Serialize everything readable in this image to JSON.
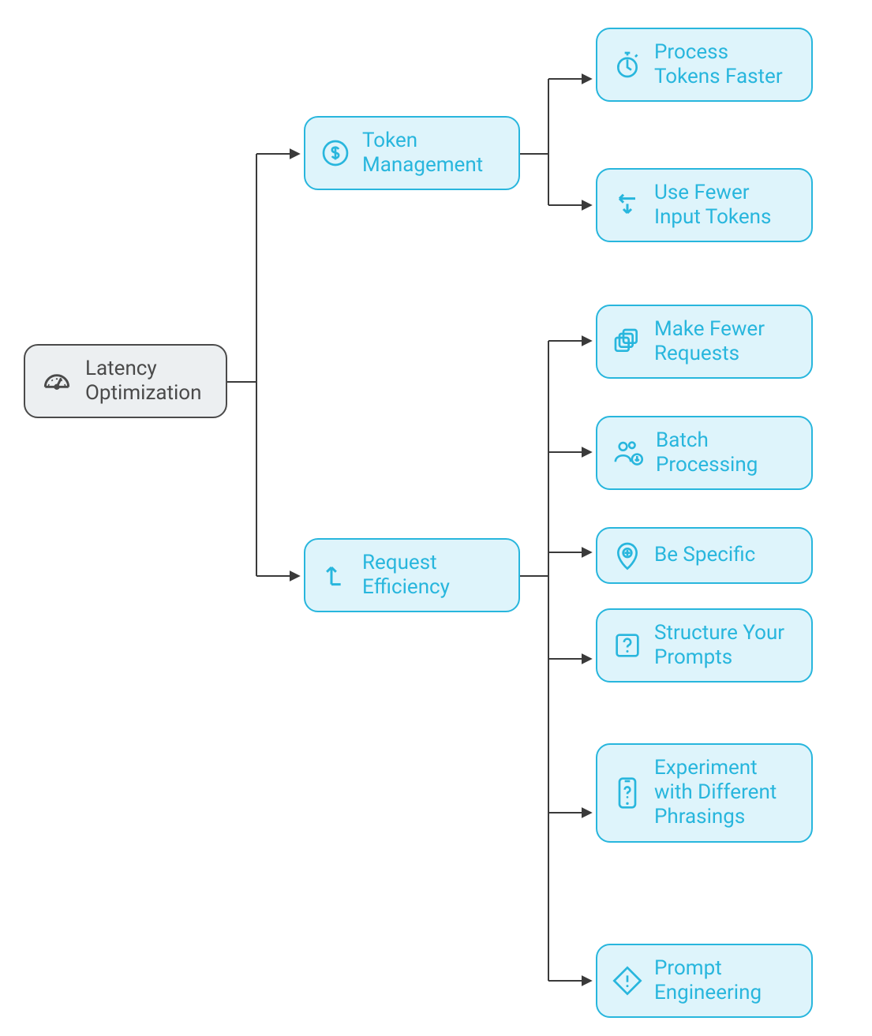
{
  "root": {
    "label": "Latency Optimization"
  },
  "categories": {
    "token": {
      "label": "Token Management"
    },
    "request": {
      "label": "Request Efficiency"
    }
  },
  "leaves": {
    "processFaster": {
      "label": "Process Tokens Faster"
    },
    "fewerInput": {
      "label": "Use Fewer Input Tokens"
    },
    "fewerReq": {
      "label": "Make Fewer Requests"
    },
    "batch": {
      "label": "Batch Processing"
    },
    "specific": {
      "label": "Be Specific"
    },
    "structure": {
      "label": "Structure Your Prompts"
    },
    "experiment": {
      "label": "Experiment with Different Phrasings"
    },
    "promptEng": {
      "label": "Prompt Engineering"
    }
  },
  "colors": {
    "rootBorder": "#4a4a4a",
    "rootBg": "#eceff1",
    "catBorder": "#28b6dd",
    "catBg": "#def4fb",
    "connector": "#3a3a3a"
  }
}
